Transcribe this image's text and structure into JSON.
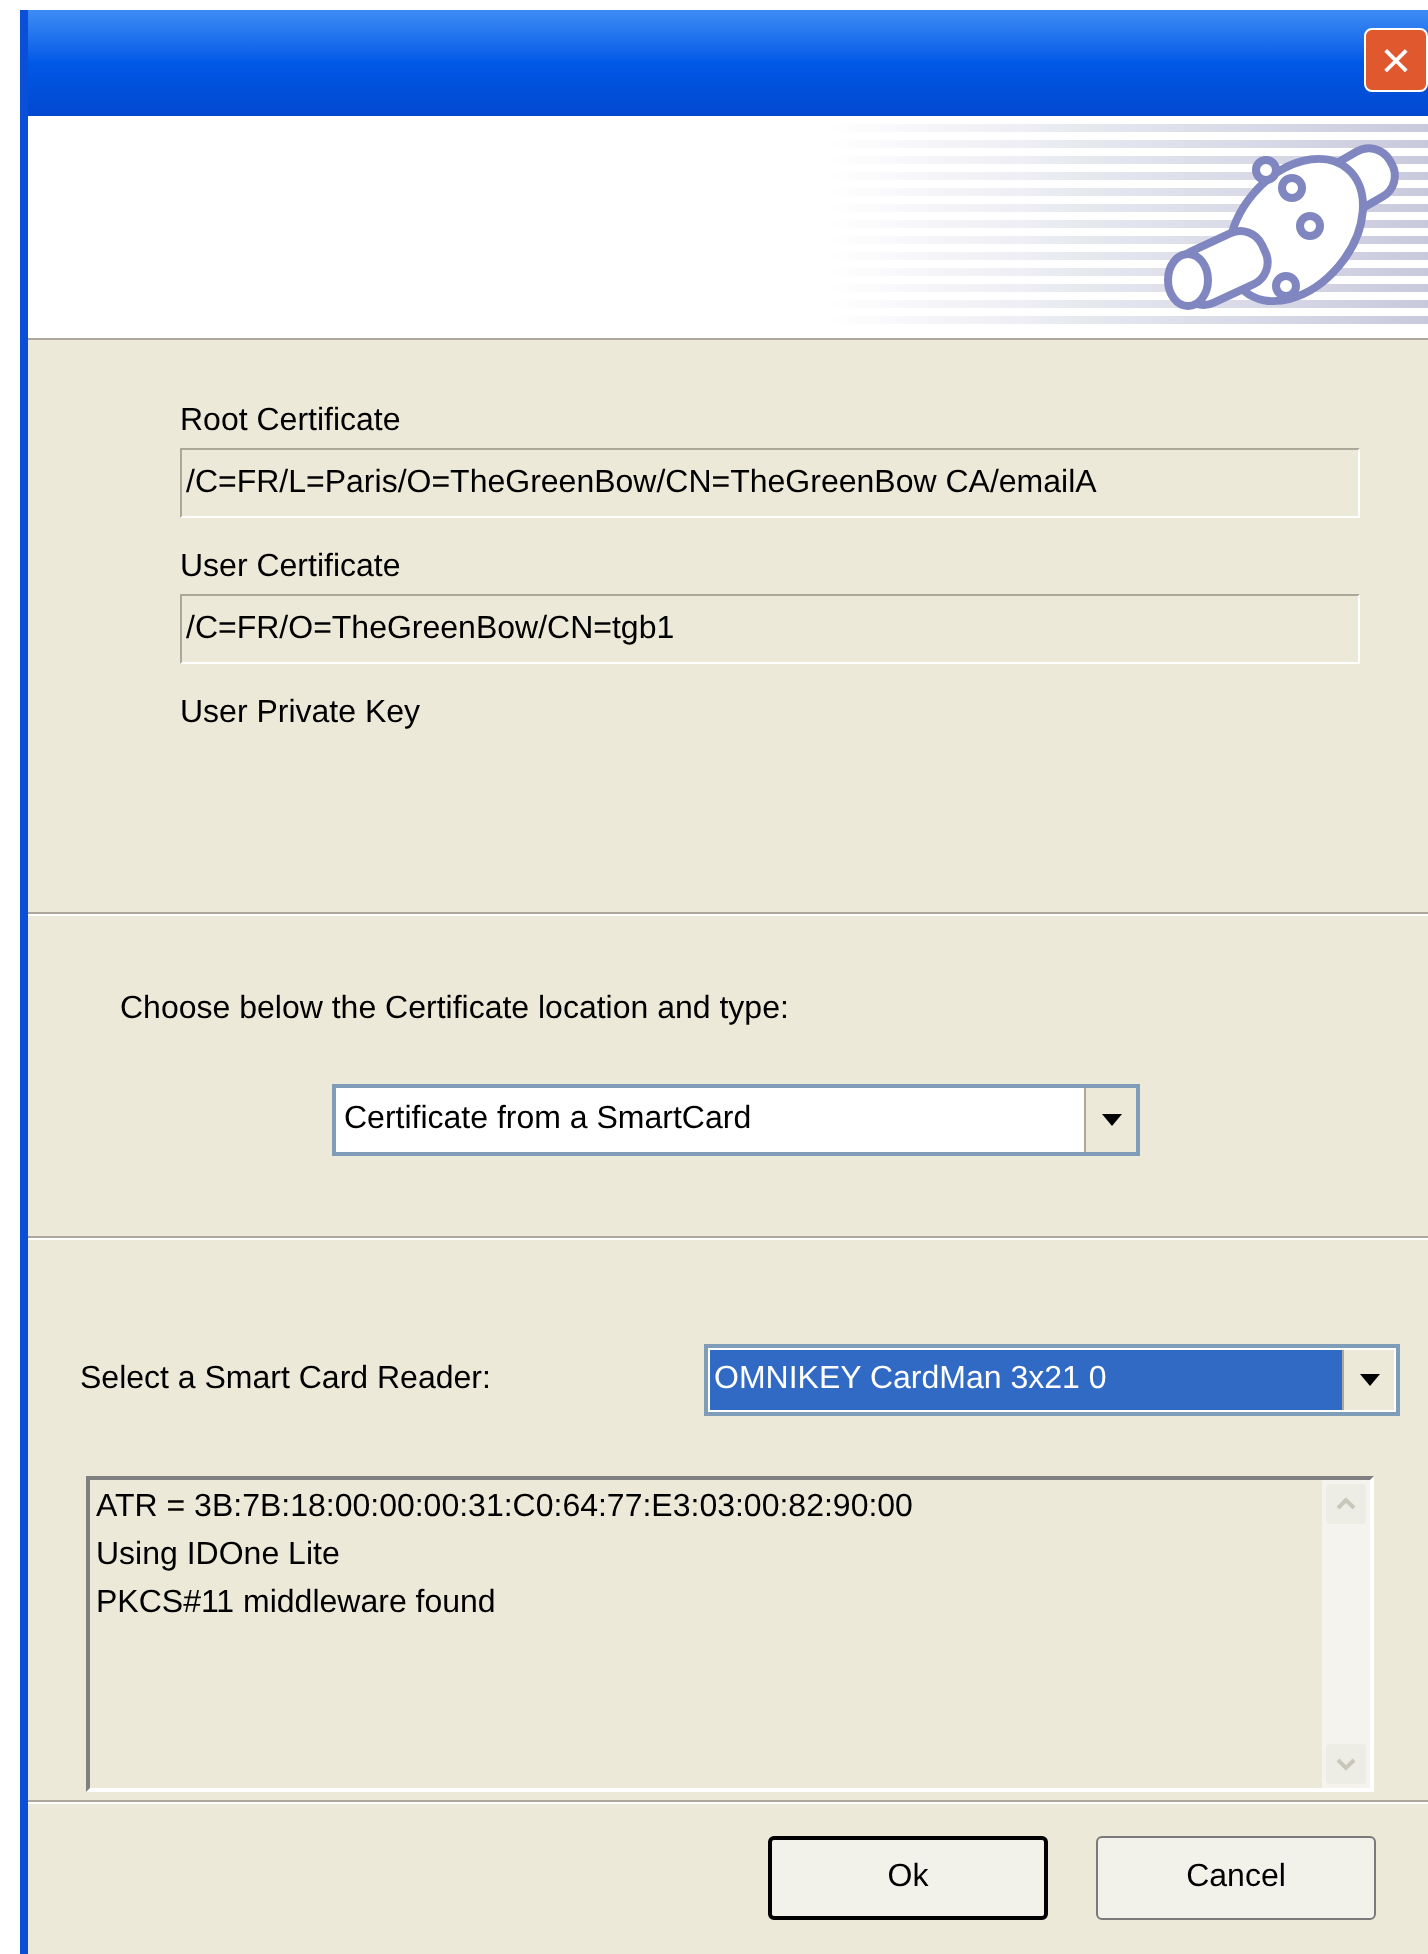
{
  "window": {
    "close_label": "×"
  },
  "fields": [
    {
      "label": "Root Certificate",
      "value": "/C=FR/L=Paris/O=TheGreenBow/CN=TheGreenBow CA/emailA"
    },
    {
      "label": "User Certificate",
      "value": "/C=FR/O=TheGreenBow/CN=tgb1"
    },
    {
      "label": "User Private Key"
    }
  ],
  "location": {
    "prompt": "Choose below the Certificate location and type:",
    "value": "Certificate from a SmartCard"
  },
  "reader": {
    "label": "Select a Smart Card Reader:",
    "value": "OMNIKEY CardMan 3x21 0",
    "focused": true
  },
  "log": [
    "ATR = 3B:7B:18:00:00:00:31:C0:64:77:E3:03:00:82:90:00",
    "Using IDOne Lite",
    "PKCS#11 middleware found"
  ],
  "buttons": [
    {
      "label": "Ok",
      "default": true
    },
    {
      "label": "Cancel",
      "default": false
    }
  ]
}
